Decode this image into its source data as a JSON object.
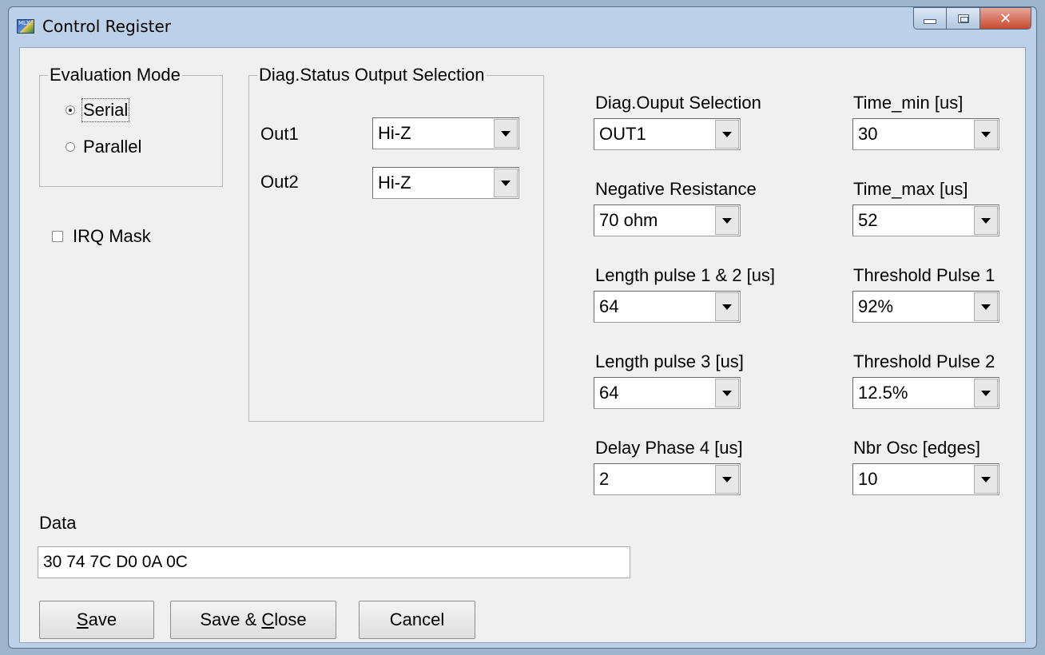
{
  "window": {
    "title": "Control Register",
    "app_icon_text": "MLX"
  },
  "evaluation_mode": {
    "label": "Evaluation Mode",
    "options": [
      {
        "label": "Serial",
        "selected": true
      },
      {
        "label": "Parallel",
        "selected": false
      }
    ]
  },
  "irq_mask": {
    "label": "IRQ Mask",
    "checked": false
  },
  "diag_status": {
    "label": "Diag.Status Output Selection",
    "out1": {
      "label": "Out1",
      "value": "Hi-Z"
    },
    "out2": {
      "label": "Out2",
      "value": "Hi-Z"
    }
  },
  "settings": {
    "diag_output": {
      "label": "Diag.Ouput Selection",
      "value": "OUT1"
    },
    "negative_resistance": {
      "label": "Negative Resistance",
      "value": "70 ohm"
    },
    "length_pulse_12": {
      "label": "Length pulse 1 & 2 [us]",
      "value": "64"
    },
    "length_pulse_3": {
      "label": "Length pulse 3 [us]",
      "value": "64"
    },
    "delay_phase_4": {
      "label": "Delay Phase 4 [us]",
      "value": "2"
    },
    "time_min": {
      "label": "Time_min [us]",
      "value": "30"
    },
    "time_max": {
      "label": "Time_max [us]",
      "value": "52"
    },
    "threshold_pulse_1": {
      "label": "Threshold Pulse 1",
      "value": "92%"
    },
    "threshold_pulse_2": {
      "label": "Threshold Pulse 2",
      "value": "12.5%"
    },
    "nbr_osc": {
      "label": "Nbr Osc [edges]",
      "value": "10"
    }
  },
  "data": {
    "label": "Data",
    "value": "30 74 7C D0 0A 0C"
  },
  "buttons": {
    "save": {
      "label_first": "S",
      "label_rest": "ave"
    },
    "save_close": {
      "label_prefix": "Save & ",
      "label_underlined": "C",
      "label_suffix": "lose"
    },
    "cancel": {
      "label": "Cancel"
    }
  },
  "icons": {
    "minimize": "minimize-icon",
    "maximize": "maximize-icon",
    "close": "close-icon",
    "dropdown": "chevron-down-icon"
  }
}
